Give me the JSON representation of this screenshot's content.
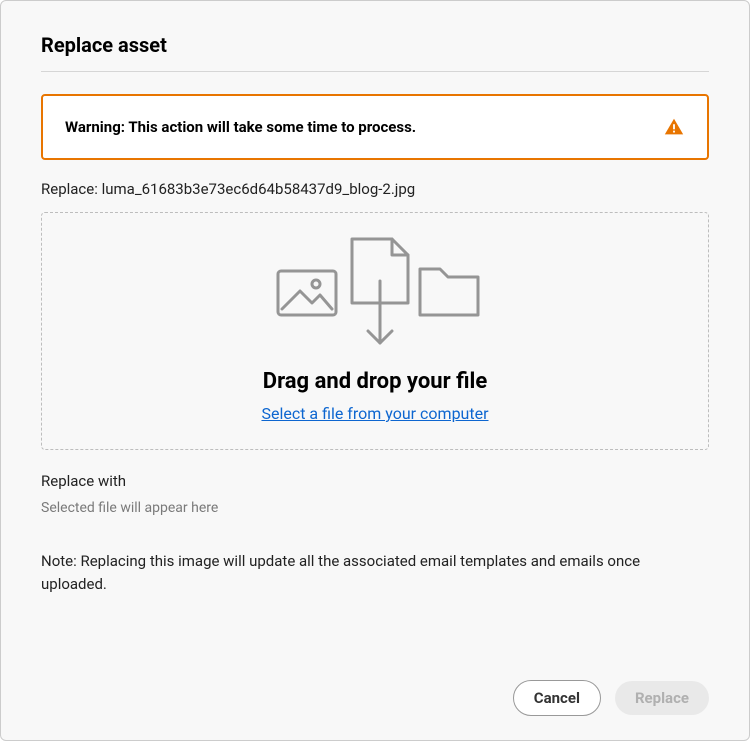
{
  "dialog": {
    "title": "Replace asset"
  },
  "warning": {
    "text": "Warning: This action will take some time to process.",
    "color": "#e87500"
  },
  "replace": {
    "label_prefix": "Replace: ",
    "filename": "luma_61683b3e73ec6d64b58437d9_blog-2.jpg"
  },
  "dropzone": {
    "title": "Drag and drop your file",
    "link": "Select a file from your computer"
  },
  "replace_with": {
    "label": "Replace with",
    "placeholder": "Selected file will appear here"
  },
  "note": "Note: Replacing this image will update all the associated email templates and emails once uploaded.",
  "buttons": {
    "cancel": "Cancel",
    "replace": "Replace"
  }
}
